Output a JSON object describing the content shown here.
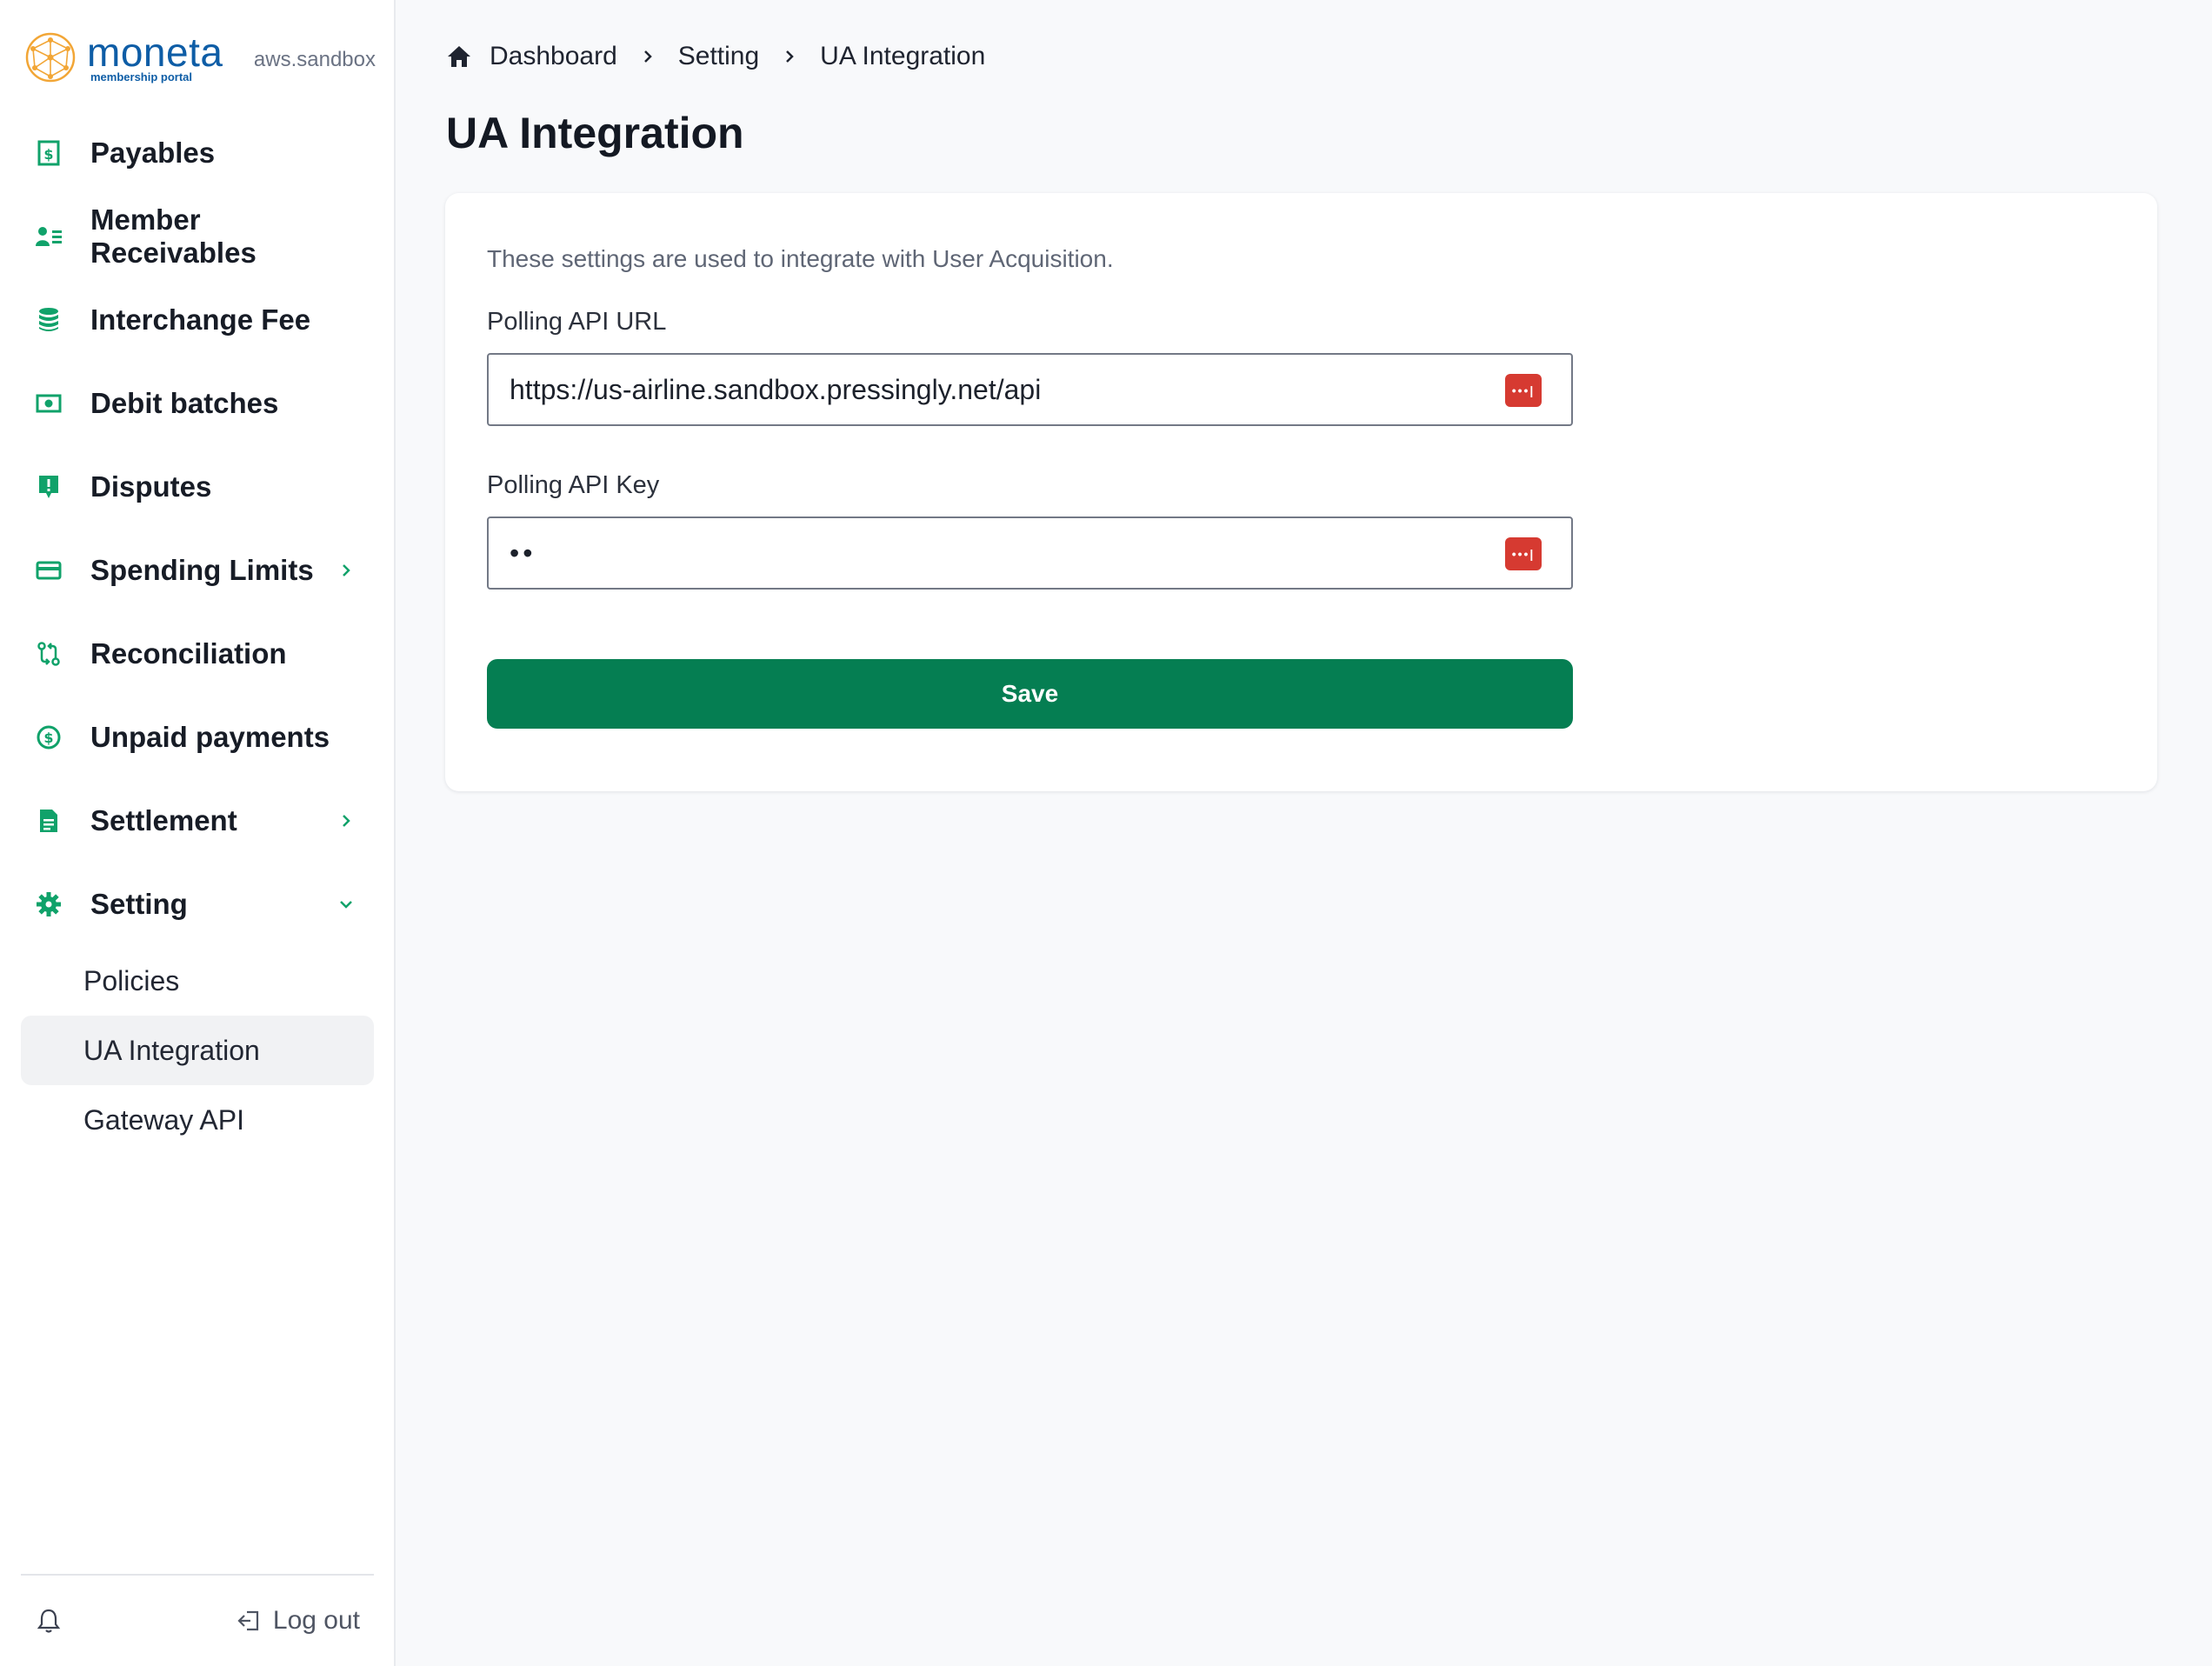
{
  "brand": {
    "name": "moneta",
    "subtitle": "membership portal",
    "environment": "aws.sandbox"
  },
  "sidebar": {
    "items": [
      {
        "label": "Payables",
        "icon": "payables-icon"
      },
      {
        "label": "Member Receivables",
        "icon": "member-list-icon"
      },
      {
        "label": "Interchange Fee",
        "icon": "database-stack-icon"
      },
      {
        "label": "Debit batches",
        "icon": "cash-icon"
      },
      {
        "label": "Disputes",
        "icon": "alert-chat-icon"
      },
      {
        "label": "Spending Limits",
        "icon": "credit-card-icon",
        "has_children": true
      },
      {
        "label": "Reconciliation",
        "icon": "git-compare-icon"
      },
      {
        "label": "Unpaid payments",
        "icon": "dollar-circle-icon"
      },
      {
        "label": "Settlement",
        "icon": "document-icon",
        "has_children": true
      },
      {
        "label": "Setting",
        "icon": "gear-icon",
        "expanded": true
      }
    ],
    "setting_children": [
      {
        "label": "Policies"
      },
      {
        "label": "UA Integration",
        "active": true
      },
      {
        "label": "Gateway API"
      }
    ],
    "footer": {
      "logout_label": "Log out"
    }
  },
  "breadcrumb": [
    "Dashboard",
    "Setting",
    "UA Integration"
  ],
  "page": {
    "title": "UA Integration",
    "description": "These settings are used to integrate with User Acquisition."
  },
  "form": {
    "url_label": "Polling API URL",
    "url_value": "https://us-airline.sandbox.pressingly.net/api",
    "key_label": "Polling API Key",
    "key_masked": "••",
    "save_label": "Save"
  },
  "colors": {
    "accent": "#057e52",
    "icon_green": "#10a26a",
    "brand_blue": "#0e5da6",
    "password_manager_red": "#d63a31"
  }
}
